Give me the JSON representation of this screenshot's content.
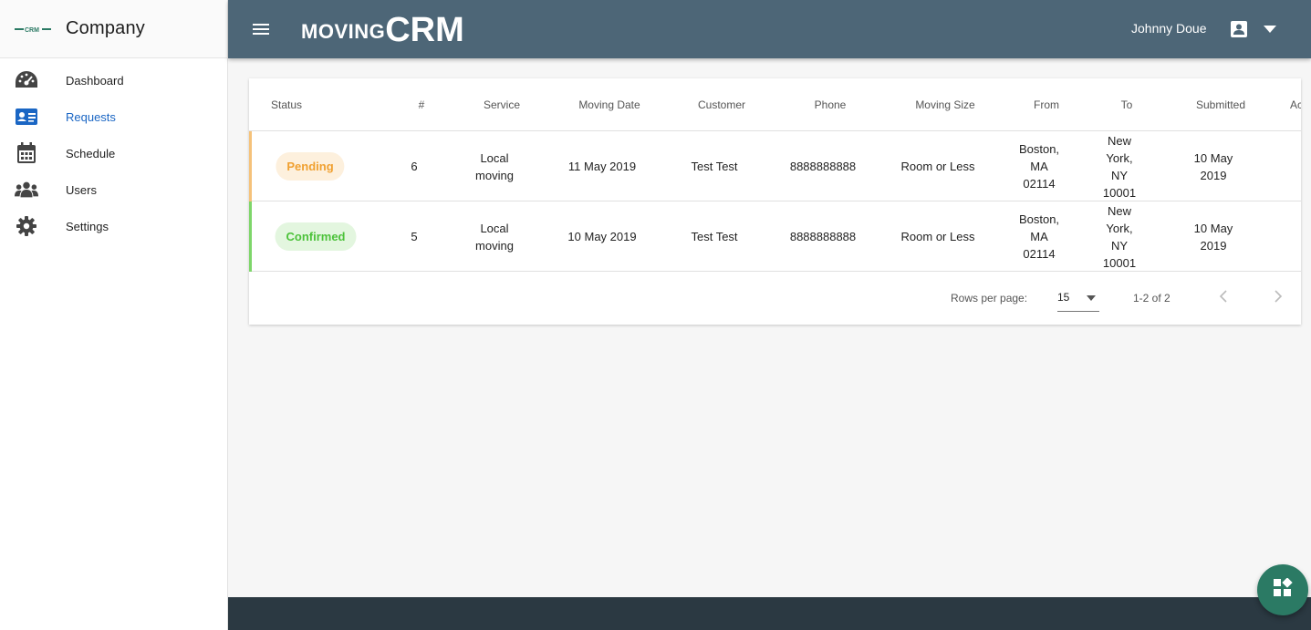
{
  "brand": {
    "logo_text": "MOVINGCRM",
    "company_name": "Company"
  },
  "sidebar": {
    "items": [
      {
        "label": "Dashboard",
        "icon": "speedometer-icon",
        "active": false
      },
      {
        "label": "Requests",
        "icon": "id-card-icon",
        "active": true
      },
      {
        "label": "Schedule",
        "icon": "calendar-icon",
        "active": false
      },
      {
        "label": "Users",
        "icon": "users-icon",
        "active": false
      },
      {
        "label": "Settings",
        "icon": "gear-icon",
        "active": false
      }
    ]
  },
  "topbar": {
    "logo_moving": "MOVING",
    "logo_crm": "CRM",
    "user_name": "Johnny Doue"
  },
  "table": {
    "headers": [
      "Status",
      "#",
      "Service",
      "Moving Date",
      "Customer",
      "Phone",
      "Moving Size",
      "From",
      "To",
      "Submitted",
      "Ac"
    ],
    "rows": [
      {
        "status": "Pending",
        "status_color": "#f0a030",
        "id": "6",
        "service": "Local moving",
        "moving_date": "11 May 2019",
        "customer": "Test Test",
        "phone": "8888888888",
        "moving_size": "Room or Less",
        "from": "Boston, MA 02114",
        "to": "New York, NY 10001",
        "submitted": "10 May 2019"
      },
      {
        "status": "Confirmed",
        "status_color": "#4cc23a",
        "id": "5",
        "service": "Local moving",
        "moving_date": "10 May 2019",
        "customer": "Test Test",
        "phone": "8888888888",
        "moving_size": "Room or Less",
        "from": "Boston, MA 02114",
        "to": "New York, NY 10001",
        "submitted": "10 May 2019"
      }
    ],
    "footer": {
      "rows_per_page_label": "Rows per page:",
      "rows_per_page_value": "15",
      "range": "1-2 of 2"
    }
  },
  "colors": {
    "topbar": "#4d6677",
    "accent": "#1a66c4",
    "pending": "#f0a030",
    "confirmed": "#4cc23a",
    "fab": "#2b7a64"
  }
}
